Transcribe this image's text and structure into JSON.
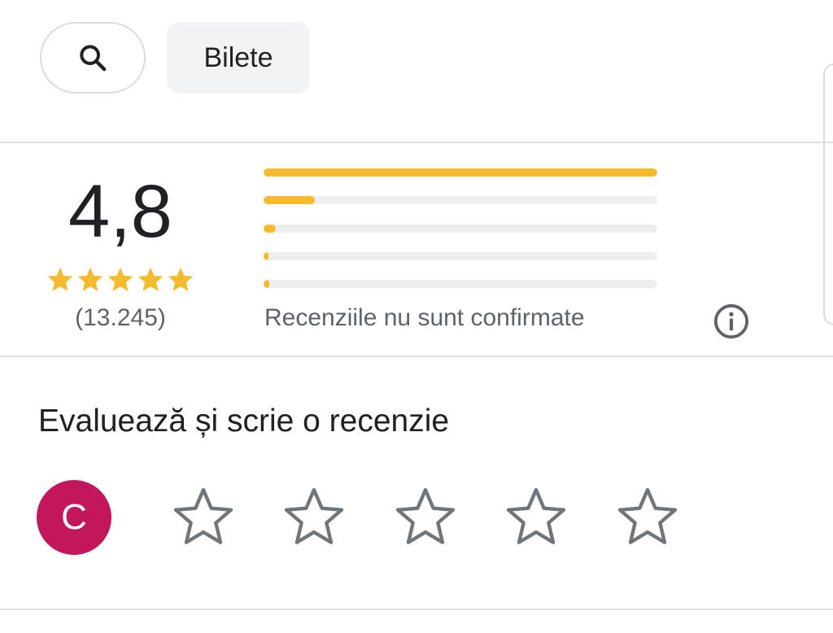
{
  "top_bar": {
    "search_icon": "search-icon",
    "chip_label": "Bilete"
  },
  "summary": {
    "rating": "4,8",
    "stars_filled": 5,
    "review_count": "(13.245)",
    "distribution": [
      {
        "stars": 5,
        "fraction": 1.0
      },
      {
        "stars": 4,
        "fraction": 0.13
      },
      {
        "stars": 3,
        "fraction": 0.03
      },
      {
        "stars": 2,
        "fraction": 0.01
      },
      {
        "stars": 1,
        "fraction": 0.015
      }
    ],
    "note": "Recenziile nu sunt confirmate",
    "info_icon": "info-icon"
  },
  "write_review": {
    "title": "Evaluează și scrie o recenzie",
    "avatar_letter": "C",
    "avatar_color": "#c2185b",
    "star_count": 5
  },
  "colors": {
    "accent_star": "#f6bb2c",
    "bar_track": "#eeeeee",
    "muted_text": "#5f6368"
  }
}
